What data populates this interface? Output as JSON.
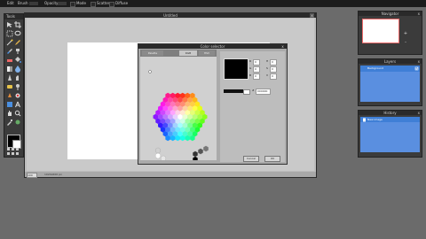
{
  "menu": {
    "items": [
      "Edit",
      "Brush",
      "Opacity",
      "Mode",
      "Scatter",
      "Diffuse"
    ]
  },
  "tools": {
    "title": "Tools"
  },
  "main_window": {
    "title": "Untitled",
    "close": "x",
    "zoom": "100",
    "dimensions": "1024x600 px"
  },
  "color_dialog": {
    "title": "Color selector",
    "close": "x",
    "tabs": [
      "Palette",
      "RGB",
      "HSV"
    ],
    "fields": [
      {
        "label": "R",
        "value": "0"
      },
      {
        "label": "G",
        "value": "0"
      },
      {
        "label": "B",
        "value": "0"
      },
      {
        "label": "H",
        "value": "0"
      },
      {
        "label": "S",
        "value": "0"
      },
      {
        "label": "V",
        "value": "0"
      }
    ],
    "hex_label": "#",
    "hex_value": "000000",
    "cancel_label": "Cancel",
    "ok_label": "OK"
  },
  "navigator": {
    "title": "Navigator",
    "close": "x",
    "zoom_in": "+",
    "zoom_out": "-"
  },
  "layers": {
    "title": "Layers",
    "close": "x",
    "items": [
      "Background"
    ]
  },
  "history": {
    "title": "History",
    "close": "x",
    "items": [
      "New image"
    ]
  },
  "colors": {
    "accent": "#3f7fd6",
    "primary_color": "#000000",
    "secondary_color": "#ffffff",
    "selection_border": "#ef6a6a"
  }
}
